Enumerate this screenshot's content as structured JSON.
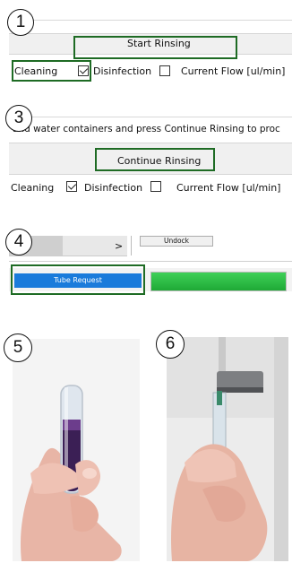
{
  "steps": [
    "1",
    "3",
    "4",
    "5",
    "6"
  ],
  "panel1": {
    "start_label": "Start Rinsing",
    "cleaning_label": "Cleaning",
    "disinfection_label": "Disinfection",
    "flow_label": "Current Flow [ul/min]"
  },
  "panel3": {
    "instruction": "and water containers and press Continue Rinsing to proc",
    "continue_label": "Continue Rinsing",
    "cleaning_label": "Cleaning",
    "disinfection_label": "Disinfection",
    "flow_label": "Current Flow [ul/min]"
  },
  "panel4": {
    "scroll_arrow": ">",
    "undock_label": "Undock",
    "tube_request_label": "Tube Request",
    "progress": 1.0
  },
  "colors": {
    "highlight": "#1e6b24",
    "tube_request": "#1a7bdb",
    "progress": "#22b33a"
  }
}
